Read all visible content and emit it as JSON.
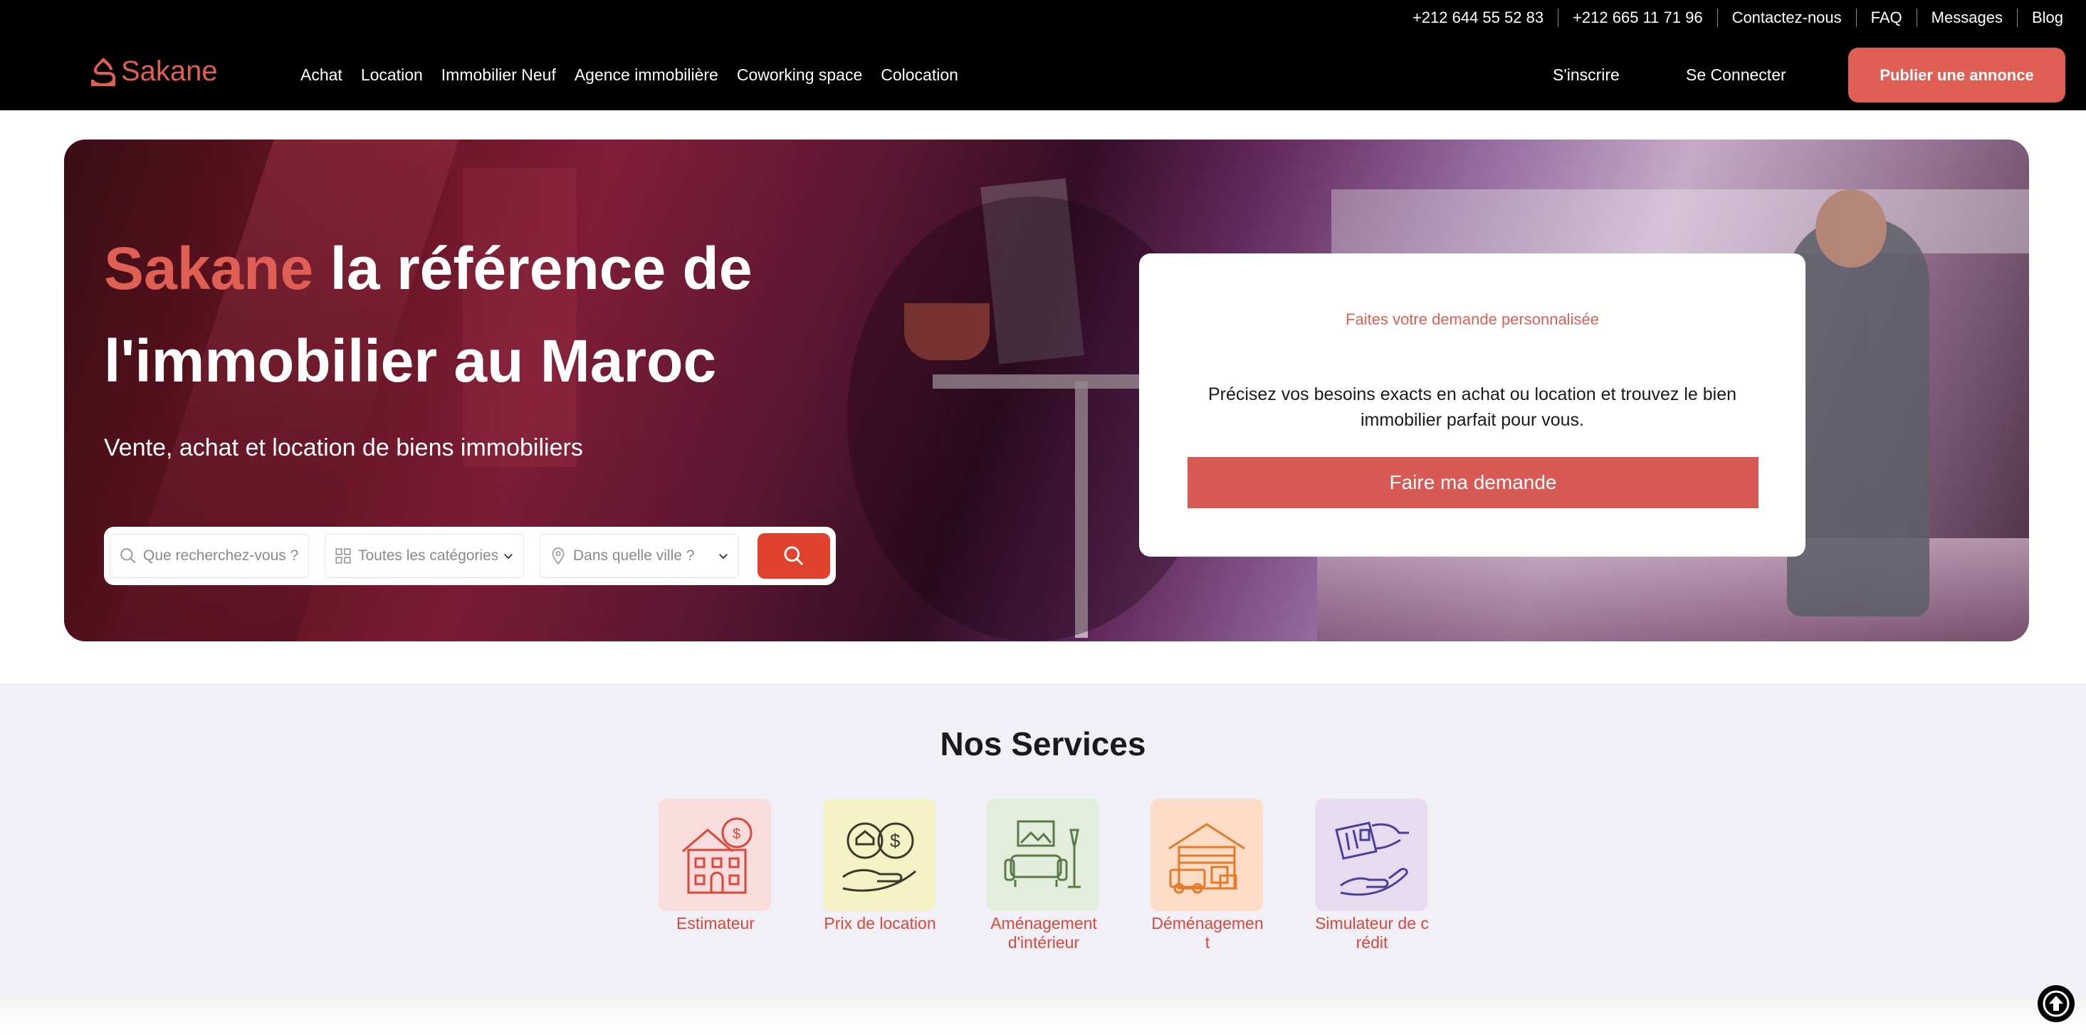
{
  "header": {
    "top_links": [
      "+212 644 55 52 83",
      "+212 665 11 71 96",
      "Contactez-nous",
      "FAQ",
      "Messages",
      "Blog"
    ],
    "logo": "Sakane",
    "nav": [
      "Achat",
      "Location",
      "Immobilier Neuf",
      "Agence immobilière",
      "Coworking space",
      "Colocation"
    ],
    "signup": "S'inscrire",
    "login": "Se Connecter",
    "publish": "Publier une annonce"
  },
  "hero": {
    "title_brand": "Sakane",
    "title_rest": "la référence de l'immobilier au Maroc",
    "subtitle": "Vente, achat et location de biens immobiliers",
    "search": {
      "query_placeholder": "Que recherchez-vous ?",
      "category_placeholder": "Toutes les catégories",
      "city_placeholder": "Dans quelle ville ?"
    }
  },
  "request_card": {
    "title": "Faites votre demande personnalisée",
    "text": "Précisez vos besoins exacts en achat ou location et trouvez le bien immobilier parfait pour vous.",
    "button": "Faire ma demande"
  },
  "services": {
    "title": "Nos Services",
    "items": [
      {
        "label": "Estimateur",
        "icon": "house-estimate-icon",
        "bg": "#f9dcdc"
      },
      {
        "label": "Prix de location",
        "icon": "rent-price-icon",
        "bg": "#f5f2c6"
      },
      {
        "label": "Aménagement d'intérieur",
        "icon": "interior-design-icon",
        "bg": "#e3eddb"
      },
      {
        "label": "Déménagement",
        "icon": "moving-truck-icon",
        "bg": "#fcdcc6"
      },
      {
        "label": "Simulateur de crédit",
        "icon": "credit-simulator-icon",
        "bg": "#e6dbef"
      }
    ]
  },
  "colors": {
    "brand": "#e05f55",
    "search_button": "#e0422e",
    "header_bg": "#000000"
  }
}
